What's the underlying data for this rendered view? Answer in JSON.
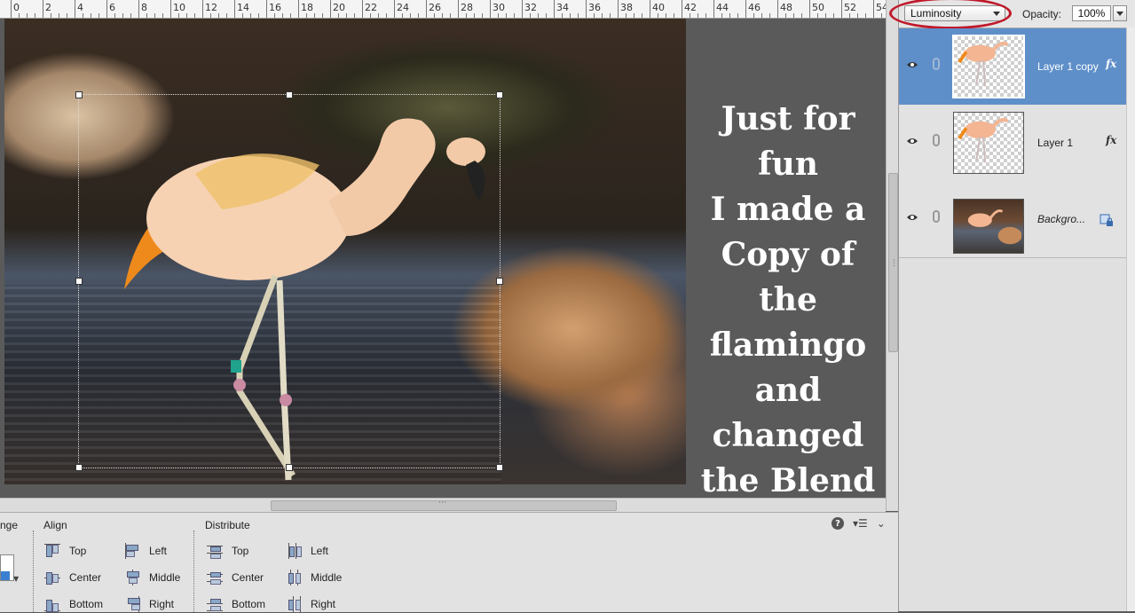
{
  "ruler": {
    "labels": [
      "0",
      "2",
      "4",
      "6",
      "8",
      "10",
      "12",
      "14",
      "16",
      "18",
      "20",
      "22",
      "24",
      "26",
      "28",
      "30",
      "32",
      "34",
      "36",
      "38",
      "40",
      "42",
      "44",
      "46",
      "48",
      "50",
      "52",
      "54"
    ]
  },
  "canvas": {
    "note_text": "Just for fun\nI made a\nCopy of the\nflamingo\nand changed\nthe Blend\nMode to\nLuminosity."
  },
  "layers_panel": {
    "blend_mode": "Luminosity",
    "opacity_label": "Opacity:",
    "opacity_value": "100%",
    "layers": [
      {
        "name": "Layer 1 copy",
        "fx": "fx",
        "selected": true
      },
      {
        "name": "Layer 1",
        "fx": "fx",
        "selected": false
      },
      {
        "name": "Backgro...",
        "locked": true,
        "selected": false
      }
    ]
  },
  "tool_options": {
    "arrange_title": "nge",
    "align": {
      "title": "Align",
      "items": [
        "Top",
        "Center",
        "Bottom",
        "Left",
        "Middle",
        "Right"
      ]
    },
    "distribute": {
      "title": "Distribute",
      "items": [
        "Top",
        "Center",
        "Bottom",
        "Left",
        "Middle",
        "Right"
      ]
    },
    "help_icon": "?",
    "menu_icon": "panel-menu-icon",
    "collapse_icon": "chevron-down-icon"
  },
  "colors": {
    "selection": "#5e8fc9",
    "highlight_ring": "#c0192b"
  }
}
